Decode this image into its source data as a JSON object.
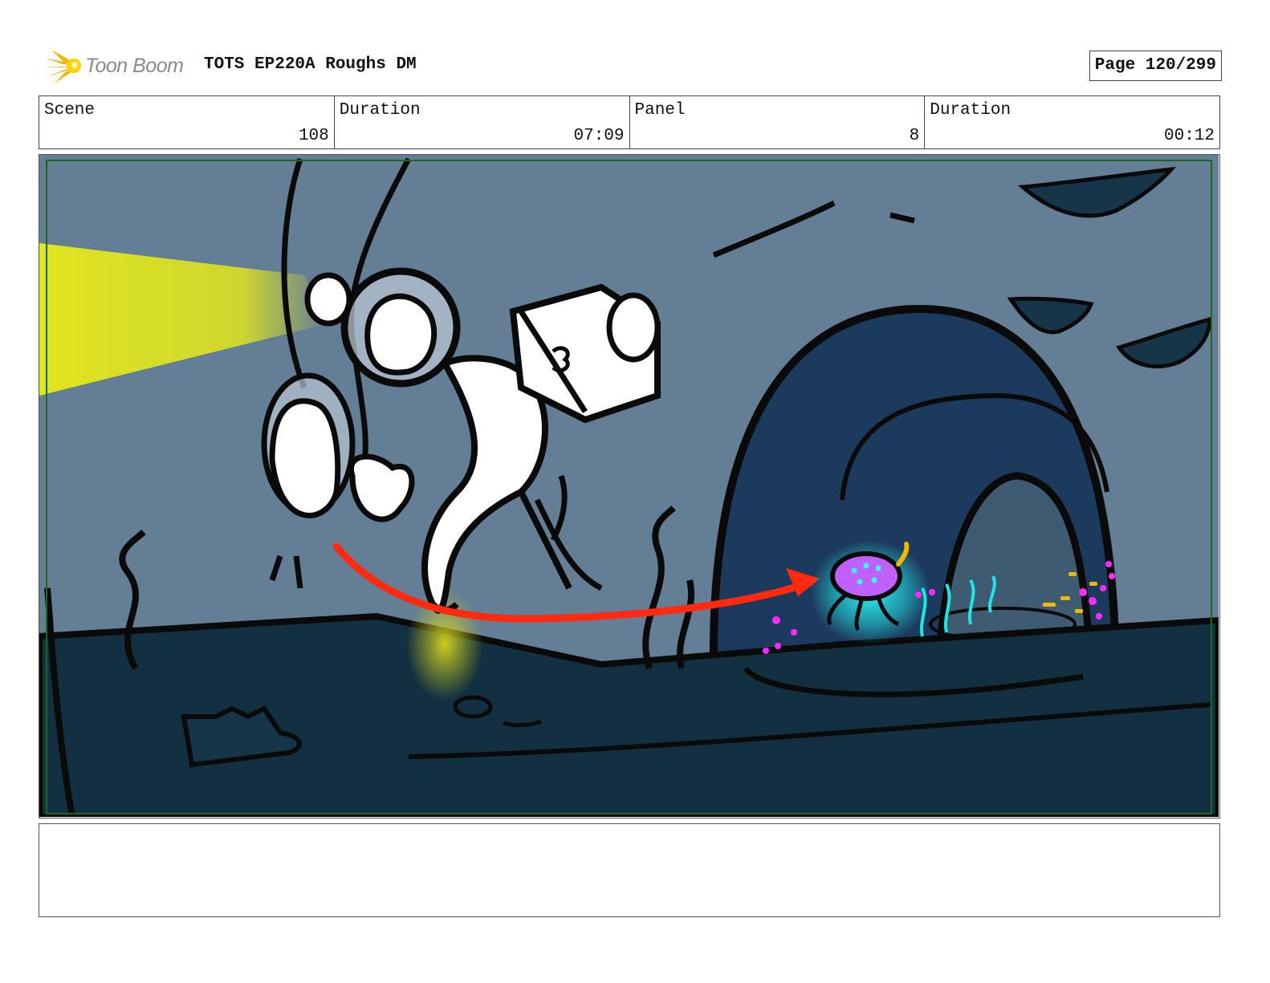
{
  "header": {
    "logo_text": "Toon Boom",
    "title": "TOTS EP220A Roughs DM",
    "page": "Page 120/299"
  },
  "info": {
    "scene_label": "Scene",
    "scene_value": "108",
    "scene_duration_label": "Duration",
    "scene_duration_value": "07:09",
    "panel_label": "Panel",
    "panel_value": "8",
    "panel_duration_label": "Duration",
    "panel_duration_value": "00:12"
  },
  "panel": {
    "image": "storyboard-sketch-underwater-divers",
    "colors": {
      "water": "#647e96",
      "floor": "#123040",
      "cave": "#1c3a5c",
      "light_beam": "#e1e61e",
      "arrow": "#ff2a10",
      "glow": "#22e0e0",
      "creature": "#c060ff"
    }
  },
  "notes": {
    "text": ""
  }
}
